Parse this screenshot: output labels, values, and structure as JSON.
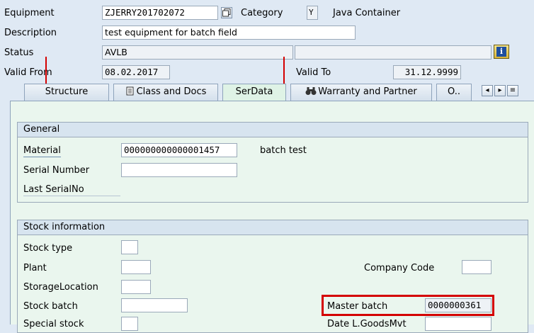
{
  "header": {
    "equipment_label": "Equipment",
    "equipment_value": "ZJERRY201702072",
    "category_label": "Category",
    "category_value": "Y",
    "category_text": "Java Container",
    "description_label": "Description",
    "description_value": "test equipment for batch field",
    "status_label": "Status",
    "status_value": "AVLB",
    "status_text_value": "",
    "valid_from_label": "Valid From",
    "valid_from_value": "08.02.2017",
    "valid_to_label": "Valid To",
    "valid_to_value": "31.12.9999"
  },
  "tabs": [
    {
      "label": "Structure"
    },
    {
      "label": "Class and Docs"
    },
    {
      "label": "SerData",
      "active": true
    },
    {
      "label": "Warranty and Partner"
    },
    {
      "label": "O.."
    }
  ],
  "icons": {
    "copy": "copy-icon",
    "info": "info-icon",
    "class_docs": "document-icon",
    "warranty": "binoculars-icon",
    "scroll_left": "chevron-left-icon",
    "scroll_right": "chevron-right-icon",
    "tab_list": "tab-list-icon"
  },
  "general": {
    "title": "General",
    "material_label": "Material",
    "material_value": "000000000000001457",
    "material_text": "batch test",
    "serial_number_label": "Serial Number",
    "serial_number_value": "",
    "last_serial_label": "Last SerialNo"
  },
  "stock": {
    "title": "Stock information",
    "stock_type_label": "Stock type",
    "plant_label": "Plant",
    "company_code_label": "Company Code",
    "storage_location_label": "StorageLocation",
    "stock_batch_label": "Stock batch",
    "master_batch_label": "Master batch",
    "master_batch_value": "0000000361",
    "special_stock_label": "Special stock",
    "date_goods_mvt_label": "Date L.GoodsMvt"
  },
  "colors": {
    "annotation_red": "#d40000",
    "panel_bg": "#eaf6ee",
    "screen_bg": "#dfe9f4"
  }
}
